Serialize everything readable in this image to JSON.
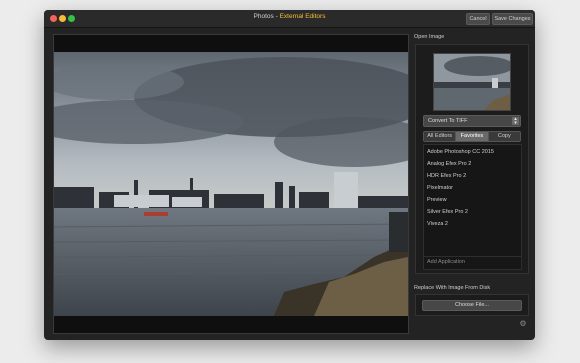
{
  "window": {
    "title_prefix": "Photos - ",
    "title_accent": "External Editors",
    "cancel_label": "Cancel",
    "save_label": "Save Changes"
  },
  "sidebar": {
    "open_image_label": "Open Image",
    "format_popup_value": "Convert To TIFF",
    "tabs": [
      {
        "label": "All Editors",
        "selected": false
      },
      {
        "label": "Favorites",
        "selected": true
      },
      {
        "label": "Copy",
        "selected": false
      }
    ],
    "applications": [
      "Adobe Photoshop CC 2015",
      "Analog Efex Pro 2",
      "HDR Efex Pro 2",
      "Pixelmator",
      "Preview",
      "Silver Efex Pro 2",
      "Viveza 2"
    ],
    "add_application_label": "Add Application",
    "replace_label": "Replace With Image From Disk",
    "choose_file_label": "Choose File..."
  },
  "colors": {
    "accent": "#f2c230",
    "window_bg": "#232323",
    "panel_bg": "#1c1c1c"
  },
  "icons": {
    "close": "close-icon",
    "minimize": "minimize-icon",
    "maximize": "maximize-icon",
    "popup_arrows": "chevron-updown-icon",
    "settings": "gear-icon"
  }
}
